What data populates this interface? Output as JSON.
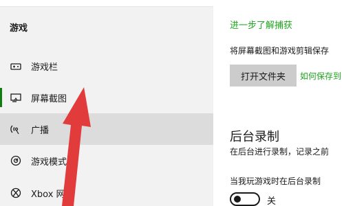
{
  "sidebar": {
    "section_title": "游戏",
    "items": [
      {
        "label": "游戏栏",
        "icon": "game-bar-icon",
        "selected": false
      },
      {
        "label": "屏幕截图",
        "icon": "captures-icon",
        "selected": true
      },
      {
        "label": "广播",
        "icon": "broadcast-icon",
        "selected": false
      },
      {
        "label": "游戏模式",
        "icon": "game-mode-icon",
        "selected": false
      },
      {
        "label": "Xbox 网络",
        "icon": "xbox-icon",
        "selected": false
      }
    ]
  },
  "main": {
    "learn_more_link": "进一步了解捕获",
    "save_description": "将屏幕截图和游戏剪辑保存",
    "open_folder_button": "打开文件夹",
    "save_link": "如何保存到",
    "background_title": "后台录制",
    "background_desc": "在后台进行录制，记录之前",
    "toggle_label": "当我玩游戏时在后台录制",
    "toggle_state": "关"
  },
  "colors": {
    "accent": "#107c10",
    "link": "#1fa51f",
    "annotation_arrow": "#e23b3b"
  }
}
